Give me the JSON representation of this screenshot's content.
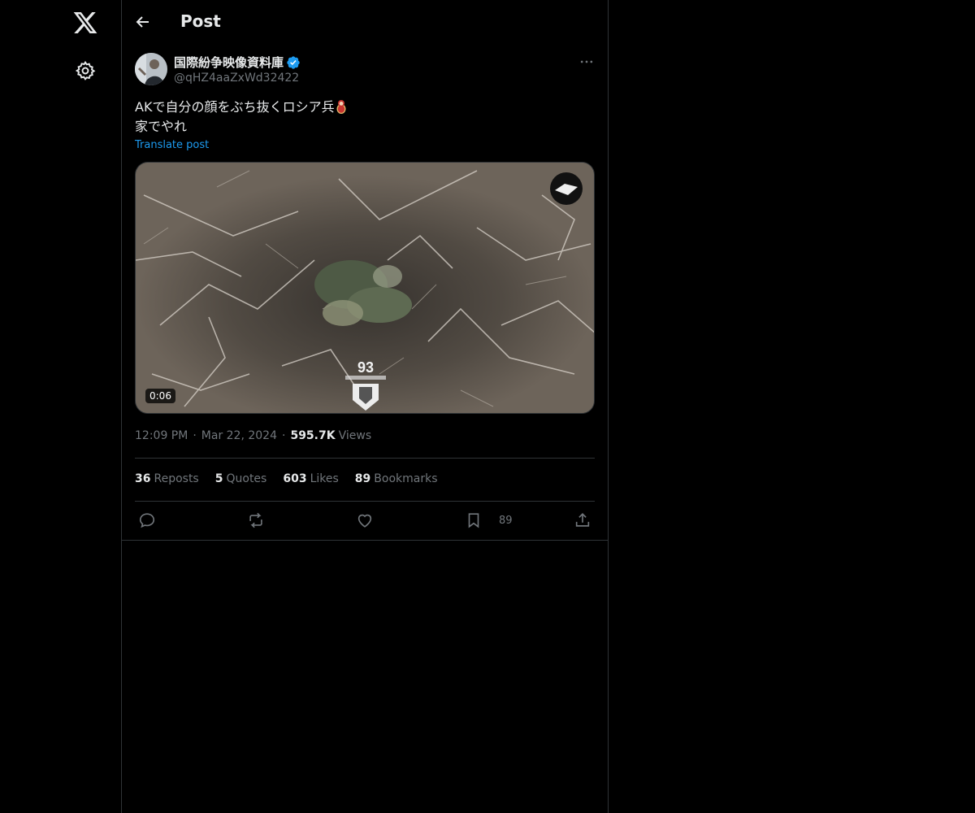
{
  "header": {
    "title": "Post"
  },
  "author": {
    "display_name": "国際紛争映像資料庫",
    "handle": "@qHZ4aaZxWd32422",
    "verified": true
  },
  "post": {
    "lines": [
      "AKで自分の顔をぶち抜くロシア兵",
      "家でやれ"
    ],
    "translate_label": "Translate post",
    "video_duration": "0:06",
    "video_overlay_text": "93"
  },
  "meta": {
    "time": "12:09 PM",
    "date": "Mar 22, 2024",
    "separator": "·",
    "views_count": "595.7K",
    "views_label": "Views"
  },
  "stats": [
    {
      "count": "36",
      "label": "Reposts"
    },
    {
      "count": "5",
      "label": "Quotes"
    },
    {
      "count": "603",
      "label": "Likes"
    },
    {
      "count": "89",
      "label": "Bookmarks"
    }
  ],
  "actions": {
    "bookmark_count": "89",
    "icons": [
      "reply-icon",
      "repost-icon",
      "like-icon",
      "bookmark-icon",
      "share-icon"
    ]
  },
  "colors": {
    "background": "#000000",
    "text": "#e7e9ea",
    "muted": "#71767b",
    "link": "#1d9bf0",
    "border": "#2f3336",
    "verified": "#1d9bf0"
  }
}
